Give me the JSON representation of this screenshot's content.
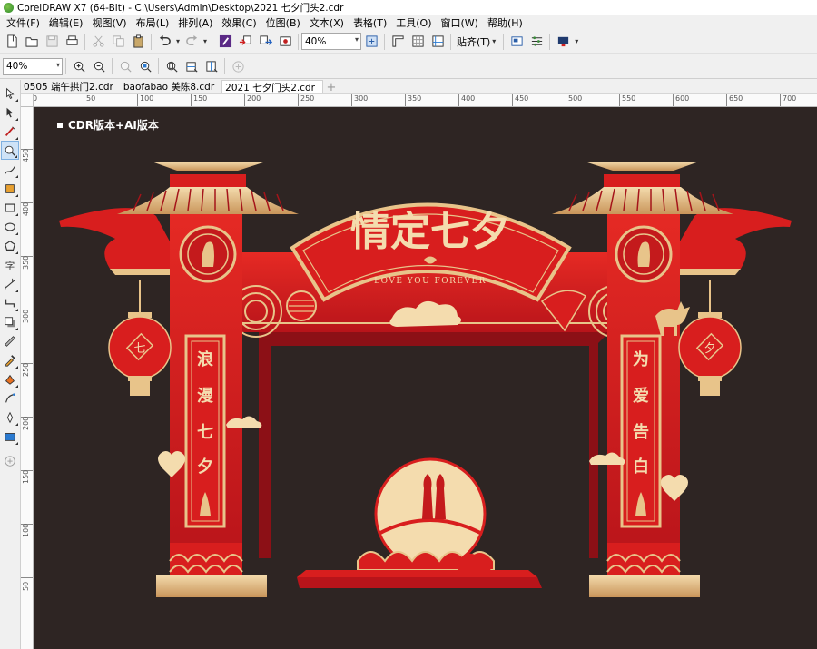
{
  "window": {
    "title": "CorelDRAW X7 (64-Bit) - C:\\Users\\Admin\\Desktop\\2021 七夕门头2.cdr"
  },
  "menu": [
    "文件(F)",
    "编辑(E)",
    "视图(V)",
    "布局(L)",
    "排列(A)",
    "效果(C)",
    "位图(B)",
    "文本(X)",
    "表格(T)",
    "工具(O)",
    "窗口(W)",
    "帮助(H)"
  ],
  "toolbar": {
    "zoom_value": "40%",
    "snap_label": "贴齐(T)"
  },
  "zoombar": {
    "zoom_value": "40%"
  },
  "tabs": [
    {
      "label": "0505 端午拱门2.cdr",
      "active": false
    },
    {
      "label": "baofabao 美陈8.cdr",
      "active": false
    },
    {
      "label": "2021 七夕门头2.cdr",
      "active": true
    }
  ],
  "ruler": {
    "horizontal": [
      "0",
      "50",
      "100",
      "150",
      "200",
      "250",
      "300",
      "350",
      "400",
      "450",
      "500",
      "550",
      "600",
      "650",
      "700"
    ],
    "vertical": [
      "450",
      "400",
      "350",
      "300",
      "250",
      "200",
      "150",
      "100",
      "50"
    ]
  },
  "canvas": {
    "label": "CDR版本+AI版本",
    "background": "#2e2523"
  },
  "artwork": {
    "title": "情定七夕",
    "subtitle": "LOVE YOU FOREVER",
    "left_couplet": [
      "浪",
      "漫",
      "七",
      "夕"
    ],
    "right_couplet": [
      "为",
      "爱",
      "告",
      "白"
    ],
    "left_lantern": "七",
    "right_lantern": "夕",
    "colors": {
      "red": "#d81e1e",
      "dark_red": "#a5141a",
      "gold": "#e8c48a",
      "deep_gold": "#c9955a"
    }
  }
}
